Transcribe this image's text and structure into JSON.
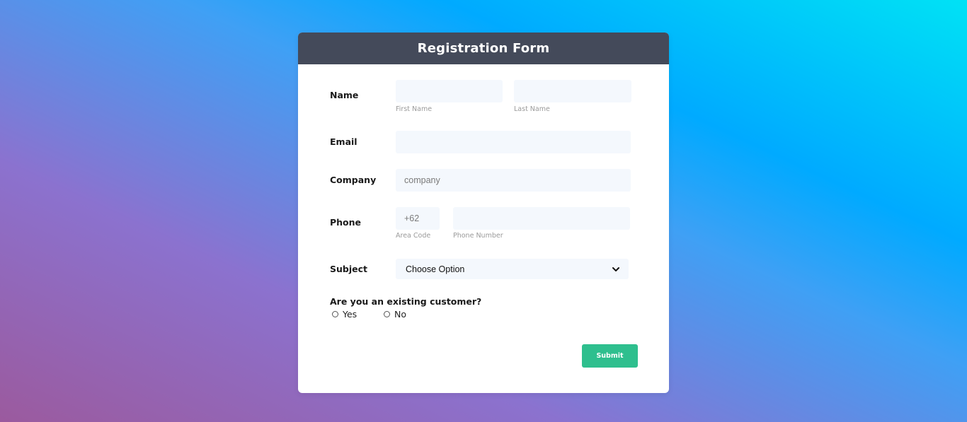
{
  "form": {
    "title": "Registration Form",
    "name": {
      "label": "Name",
      "first": {
        "value": "",
        "placeholder": "",
        "sublabel": "First Name"
      },
      "last": {
        "value": "",
        "placeholder": "",
        "sublabel": "Last Name"
      }
    },
    "email": {
      "label": "Email",
      "value": "",
      "placeholder": ""
    },
    "company": {
      "label": "Company",
      "value": "",
      "placeholder": "company"
    },
    "phone": {
      "label": "Phone",
      "area": {
        "value": "",
        "placeholder": "+62",
        "sublabel": "Area Code"
      },
      "number": {
        "value": "",
        "placeholder": "",
        "sublabel": "Phone Number"
      }
    },
    "subject": {
      "label": "Subject",
      "selected": "Choose Option"
    },
    "customer": {
      "question": "Are you an existing customer?",
      "options": [
        "Yes",
        "No"
      ]
    },
    "submit_label": "Submit"
  }
}
